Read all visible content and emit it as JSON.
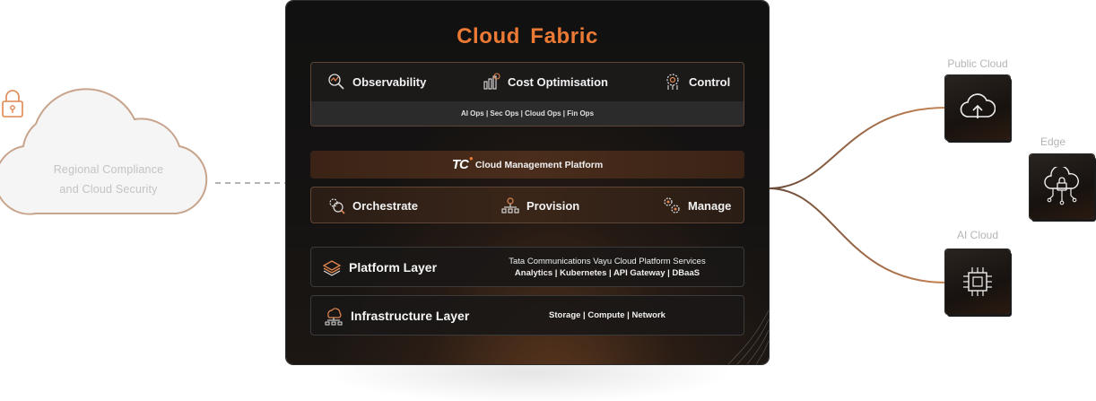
{
  "compliance_cloud": {
    "lines": [
      "Regional Compliance",
      "and Cloud Security"
    ],
    "icon": "lock-icon"
  },
  "fabric": {
    "title": "Cloud  Fabric",
    "observability_row": {
      "items": [
        {
          "label": "Observability",
          "icon": "observability-icon"
        },
        {
          "label": "Cost Optimisation",
          "icon": "cost-optimisation-icon"
        },
        {
          "label": "Control",
          "icon": "control-icon"
        }
      ],
      "subtitle": "AI Ops | Sec Ops | Cloud Ops | Fin Ops"
    },
    "cmp": {
      "logo": "TC",
      "label": "Cloud Management Platform"
    },
    "operations_row": {
      "items": [
        {
          "label": "Orchestrate",
          "icon": "orchestrate-icon"
        },
        {
          "label": "Provision",
          "icon": "provision-icon"
        },
        {
          "label": "Manage",
          "icon": "manage-icon"
        }
      ]
    },
    "platform_layer": {
      "title": "Platform Layer",
      "icon": "layers-icon",
      "desc_line1": "Tata Communications Vayu Cloud Platform Services",
      "desc_line2": "Analytics | Kubernetes | API Gateway | DBaaS"
    },
    "infrastructure_layer": {
      "title": "Infrastructure  Layer",
      "icon": "infrastructure-icon",
      "desc": "Storage | Compute | Network"
    }
  },
  "destinations": [
    {
      "label": "Public Cloud",
      "icon": "cloud-upload-icon"
    },
    {
      "label": "Edge",
      "icon": "edge-cloud-lock-icon"
    },
    {
      "label": "AI Cloud",
      "icon": "chip-icon"
    }
  ],
  "colors": {
    "accent": "#ec7a35",
    "connector": "#b8734a",
    "panel": "#111111"
  }
}
